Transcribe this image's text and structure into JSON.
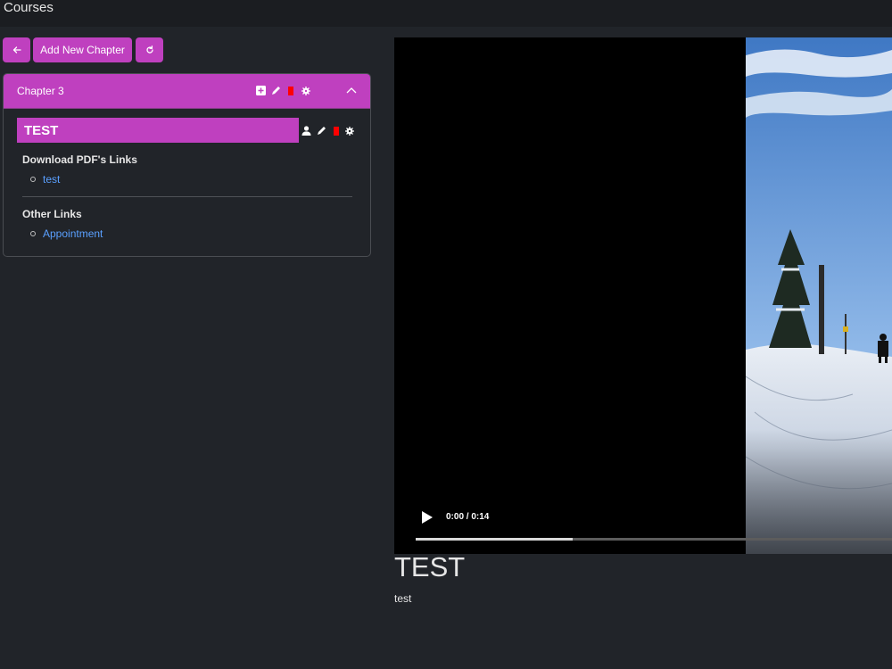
{
  "app": {
    "title": "Courses"
  },
  "toolbar": {
    "back_icon": "arrow-left-icon",
    "add_chapter_label": "Add New Chapter",
    "refresh_icon": "refresh-icon"
  },
  "chapter": {
    "title": "Chapter 3",
    "header_icons": [
      "plus-square-icon",
      "pencil-icon",
      "trash-icon",
      "gear-icon",
      "chevron-up-icon"
    ],
    "lesson": {
      "title": "TEST",
      "icons": [
        "user-icon",
        "pencil-icon",
        "trash-icon",
        "gear-icon"
      ]
    },
    "sections": [
      {
        "title": "Download PDF's Links",
        "links": [
          "test"
        ]
      },
      {
        "title": "Other Links",
        "links": [
          "Appointment"
        ]
      }
    ]
  },
  "video": {
    "time": "0:00 / 0:14",
    "progress": 0.33
  },
  "content": {
    "title": "TEST",
    "description": "test"
  },
  "colors": {
    "accent": "#bf40bf",
    "background": "#212429",
    "link": "#5aa0ff",
    "delete": "#ff0000"
  }
}
